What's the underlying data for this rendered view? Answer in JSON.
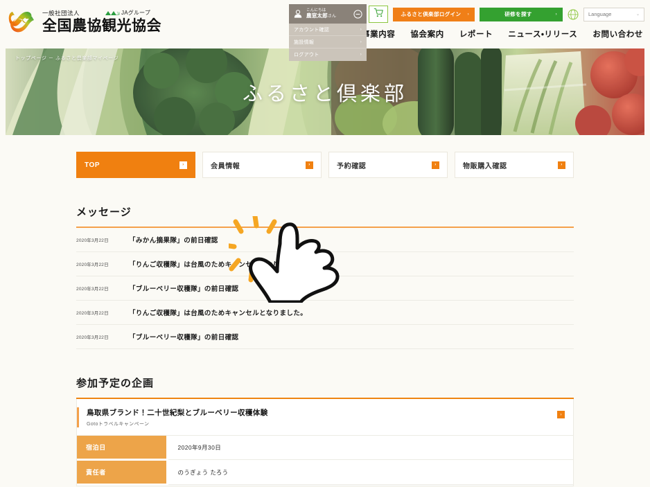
{
  "header": {
    "logo": {
      "kind": "一般社団法人",
      "group": "JAグループ",
      "name": "全国農協観光協会",
      "logo_icon": "zennoh-swirl-logo",
      "ja_icon": "ja-group-icon"
    },
    "account": {
      "greeting": "こんにちは",
      "user_name": "農窓太郎",
      "user_suffix": "さん",
      "person_icon": "person-icon",
      "toggle_icon": "minus-circle-icon",
      "menu": [
        {
          "label": "アカウント確認",
          "arrow": "›"
        },
        {
          "label": "施設情報",
          "arrow": "›"
        },
        {
          "label": "ログアウト",
          "arrow": "›"
        }
      ]
    },
    "utilities": {
      "cart_icon": "shopping-cart-icon",
      "login_button": "ふるさと倶楽部ログイン",
      "login_chevron": "›",
      "search_button": "研修を探す",
      "search_chevron": "›",
      "globe_icon": "globe-icon",
      "language_label": "Language",
      "language_caret": "⌄"
    },
    "nav": [
      {
        "label": "事業内容"
      },
      {
        "label": "協会案内"
      },
      {
        "label": "レポート"
      },
      {
        "label": "ニュース・リリース"
      },
      {
        "label": "お問い合わせ"
      }
    ]
  },
  "hero": {
    "breadcrumb": "トップページ － ふるさと倶楽部マイページ",
    "title": "ふるさと倶楽部"
  },
  "tabs": [
    {
      "label": "TOP",
      "marker": "›",
      "active": true
    },
    {
      "label": "会員情報",
      "marker": "›",
      "active": false
    },
    {
      "label": "予約確認",
      "marker": "›",
      "active": false
    },
    {
      "label": "物販購入確認",
      "marker": "›",
      "active": false
    }
  ],
  "messages": {
    "title": "メッセージ",
    "items": [
      {
        "date": "2020年3月22日",
        "text": "「みかん摘果隊」の前日確認"
      },
      {
        "date": "2020年3月22日",
        "text": "「りんご収穫隊」は台風のためキャンセルとなりました。"
      },
      {
        "date": "2020年3月22日",
        "text": "「ブルーベリー収穫隊」の前日確認"
      },
      {
        "date": "2020年3月22日",
        "text": "「りんご収穫隊」は台風のためキャンセルとなりました。"
      },
      {
        "date": "2020年3月22日",
        "text": "「ブルーベリー収穫隊」の前日確認"
      }
    ]
  },
  "plans": {
    "title": "参加予定の企画",
    "card": {
      "title": "鳥取県ブランド！二十世紀梨とブルーベリー収穫体験",
      "subtitle": "Gotoトラベルキャンペーン",
      "marker": "›",
      "rows": [
        {
          "label": "宿泊日",
          "value": "2020年9月30日"
        },
        {
          "label": "責任者",
          "value": "のうぎょう たろう"
        }
      ]
    }
  },
  "colors": {
    "accent_orange": "#f08010",
    "accent_green": "#34a130",
    "rule_orange": "#f5a04a",
    "table_header": "#eda449",
    "page_bg": "#fbfaf5",
    "account_bg": "#8a8279",
    "account_menu_bg": "#cbc4ba"
  },
  "cursor": {
    "icon": "pointing-hand-cursor"
  }
}
